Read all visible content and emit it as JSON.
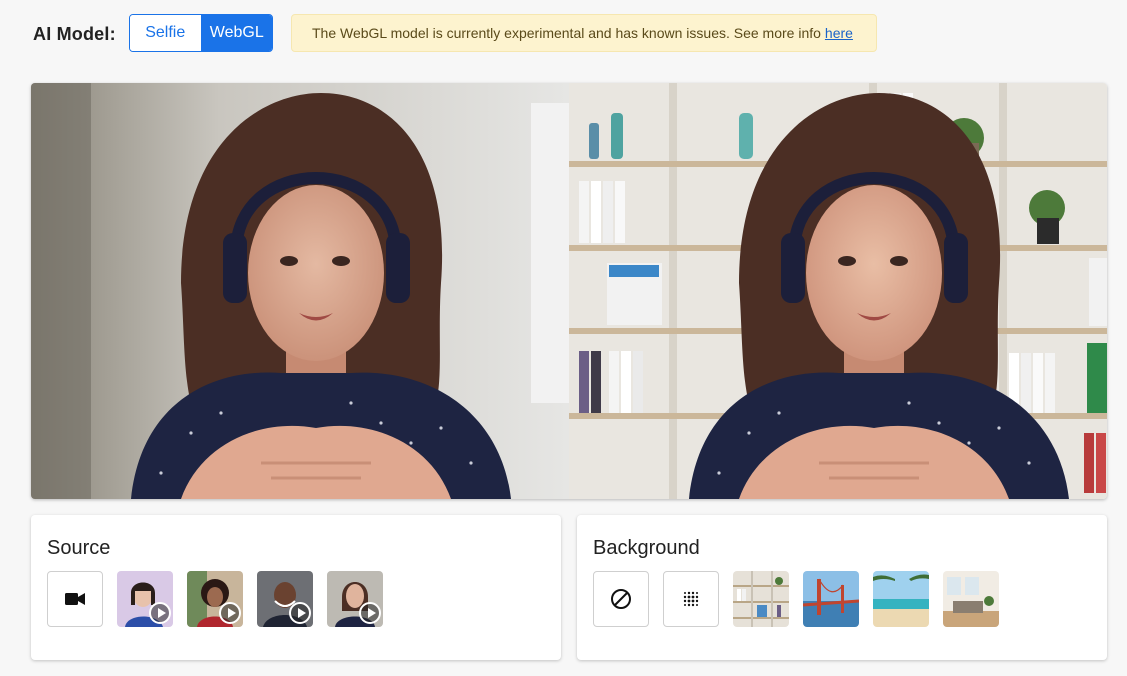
{
  "header": {
    "model_label": "AI Model:",
    "models": [
      "Selfie",
      "WebGL"
    ],
    "selected_model": "WebGL",
    "notice_text": "The WebGL model is currently experimental and has known issues. See more info",
    "notice_link": "here"
  },
  "source": {
    "title": "Source",
    "camera_icon": "video-camera-icon",
    "videos": [
      "video-thumbnail-1",
      "video-thumbnail-2",
      "video-thumbnail-3",
      "video-thumbnail-4"
    ]
  },
  "background": {
    "title": "Background",
    "none_icon": "no-background-icon",
    "blur_icon": "blur-icon",
    "images": [
      "bookshelf-background",
      "golden-gate-bridge-background",
      "beach-background",
      "living-room-background"
    ]
  },
  "colors": {
    "accent": "#1a73e8",
    "notice_bg": "#fdf3cf",
    "page_bg": "#f7f7f7"
  }
}
